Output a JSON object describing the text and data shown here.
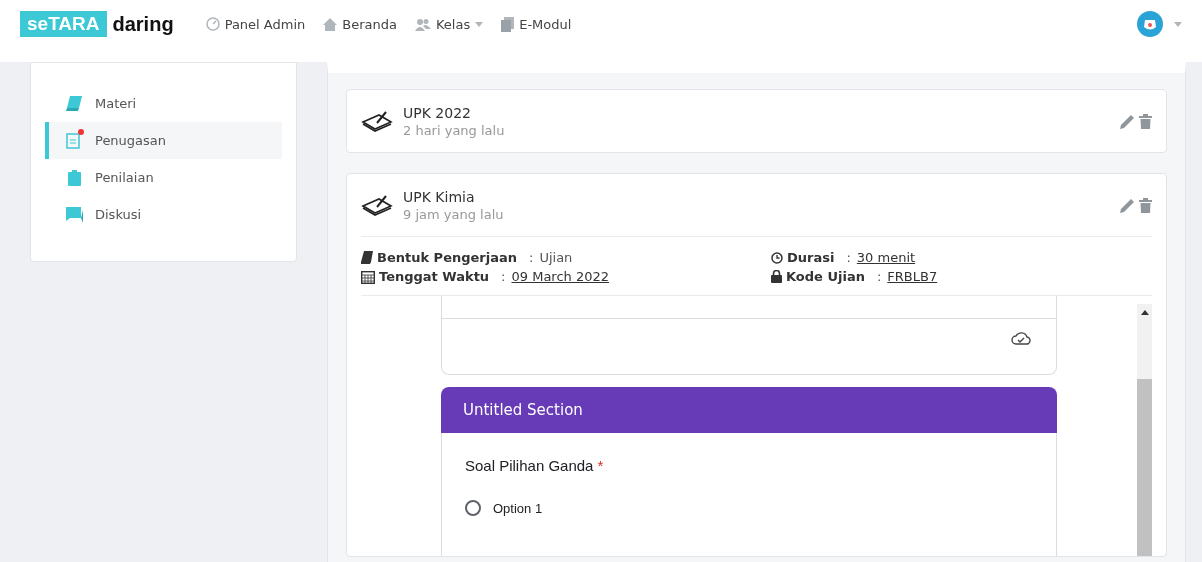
{
  "brand": {
    "logo_box": "seTARA",
    "logo_text": "daring"
  },
  "nav": [
    {
      "label": "Panel Admin",
      "dropdown": false
    },
    {
      "label": "Beranda",
      "dropdown": false
    },
    {
      "label": "Kelas",
      "dropdown": true
    },
    {
      "label": "E-Modul",
      "dropdown": false
    }
  ],
  "sidebar": {
    "items": [
      {
        "label": "Materi",
        "selected": false,
        "notification": false
      },
      {
        "label": "Penugasan",
        "selected": true,
        "notification": true
      },
      {
        "label": "Penilaian",
        "selected": false,
        "notification": false
      },
      {
        "label": "Diskusi",
        "selected": false,
        "notification": false
      }
    ]
  },
  "assignments": [
    {
      "title": "UPK 2022",
      "time": "2 hari yang lalu",
      "expanded": false
    },
    {
      "title": "UPK Kimia",
      "time": "9 jam yang lalu",
      "expanded": true,
      "details": [
        {
          "label": "Bentuk Pengerjaan",
          "colon": ":",
          "value": "Ujian",
          "link": false
        },
        {
          "label": "Durasi",
          "colon": ":",
          "value": "30 menit",
          "link": true
        },
        {
          "label": "Tenggat Waktu",
          "colon": ":",
          "value": "09 March 2022",
          "link": true
        },
        {
          "label": "Kode Ujian",
          "colon": ":",
          "value": "FRBLB7",
          "link": true
        }
      ]
    }
  ],
  "form": {
    "section_title": "Untitled Section",
    "question": "Soal Pilihan Ganda",
    "required_mark": "*",
    "options": [
      {
        "label": "Option 1",
        "selected": false
      }
    ]
  }
}
